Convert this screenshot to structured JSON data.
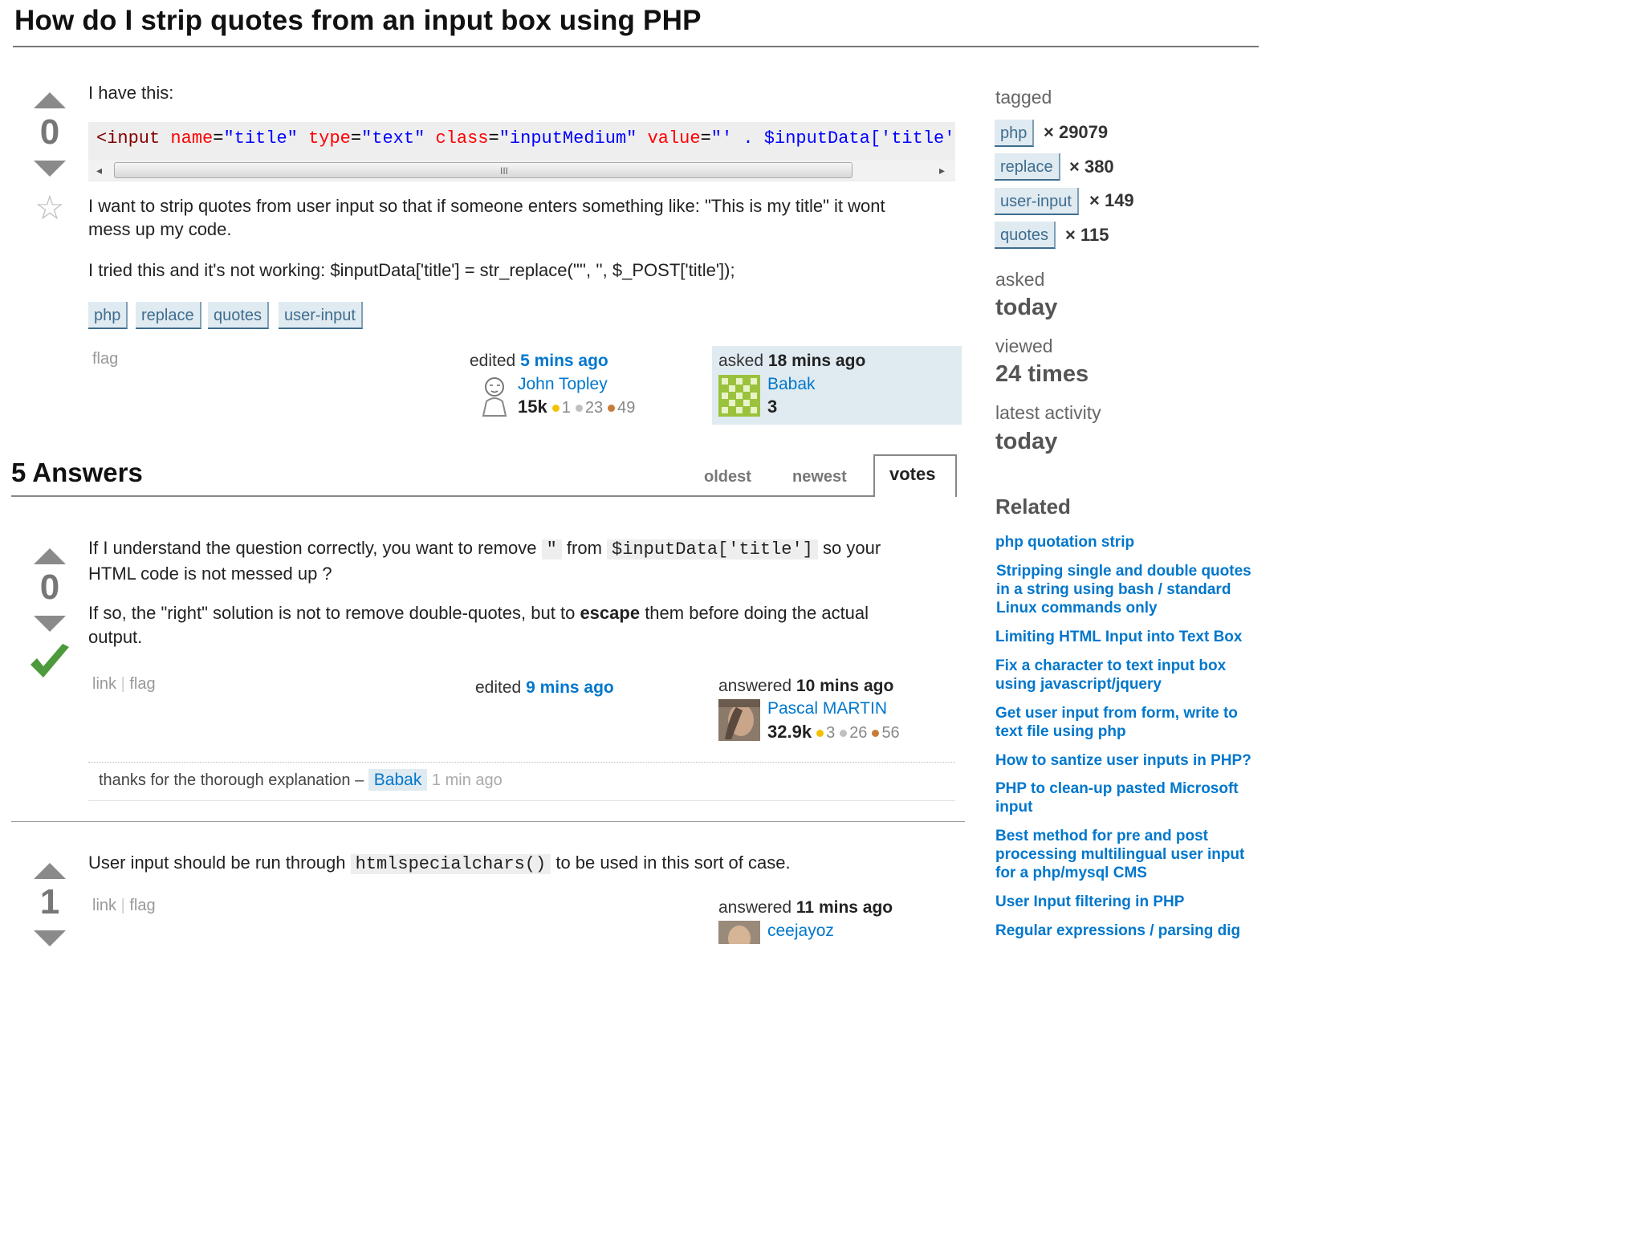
{
  "question": {
    "title": "How do I strip quotes from an input box using PHP",
    "votes": "0",
    "intro": "I have this:",
    "code": {
      "t1": "<input",
      "a1": "name",
      "v1": "\"title\"",
      "a2": "type",
      "v2": "\"text\"",
      "a3": "class",
      "v3": "\"inputMedium\"",
      "a4": "value",
      "v4": "\"'",
      "rest": " . $inputData['title']"
    },
    "para1_line1": "I want to strip quotes from user input so that if someone enters something like: \"This is my title\" it wont",
    "para1_line2": "mess up my code.",
    "para2": "I tried this and it's not working: $inputData['title'] = str_replace('\"', '', $_POST['title']);",
    "tags": [
      "php",
      "replace",
      "quotes",
      "user-input"
    ],
    "flag": "flag",
    "edited_label": "edited",
    "edited_time": "5 mins ago",
    "editor": {
      "name": "John Topley",
      "rep": "15k",
      "gold": "1",
      "silver": "23",
      "bronze": "49"
    },
    "asked_label": "asked",
    "asked_time": "18 mins ago",
    "owner": {
      "name": "Babak",
      "rep": "3"
    }
  },
  "answers_header": "5 Answers",
  "tabs": [
    "oldest",
    "newest",
    "votes"
  ],
  "answer1": {
    "votes": "0",
    "p1_a": "If I understand the question correctly, you want to remove",
    "p1_code1": "\"",
    "p1_b": "from",
    "p1_code2": "$inputData['title']",
    "p1_c": "so your",
    "p1_line2": "HTML code is not messed up ?",
    "p2_a": "If so, the \"right\" solution is not to remove double-quotes, but to",
    "p2_bold": "escape",
    "p2_b": "them before doing the actual",
    "p2_line2": "output.",
    "link": "link",
    "flag": "flag",
    "edited_label": "edited",
    "edited_time": "9 mins ago",
    "answered_label": "answered",
    "answered_time": "10 mins ago",
    "author": {
      "name": "Pascal MARTIN",
      "rep": "32.9k",
      "gold": "3",
      "silver": "26",
      "bronze": "56"
    },
    "comment": {
      "text": "thanks for the thorough explanation –",
      "user": "Babak",
      "time": "1 min ago"
    }
  },
  "answer2": {
    "votes": "1",
    "p1_a": "User input should be run through",
    "p1_code": "htmlspecialchars()",
    "p1_b": "to be used in this sort of case.",
    "link": "link",
    "flag": "flag",
    "answered_label": "answered",
    "answered_time": "11 mins ago",
    "author": {
      "name": "ceejayoz"
    }
  },
  "sidebar": {
    "tagged_label": "tagged",
    "tag_counts": [
      {
        "tag": "php",
        "count": "× 29079"
      },
      {
        "tag": "replace",
        "count": "× 380"
      },
      {
        "tag": "user-input",
        "count": "× 149"
      },
      {
        "tag": "quotes",
        "count": "× 115"
      }
    ],
    "asked_label": "asked",
    "asked_value": "today",
    "viewed_label": "viewed",
    "viewed_value": "24 times",
    "activity_label": "latest activity",
    "activity_value": "today",
    "related_title": "Related",
    "related": [
      "php quotation strip",
      "Stripping single and double quotes in a string using bash / standard Linux commands only",
      "Limiting HTML Input into Text Box",
      "Fix a character to text input box using javascript/jquery",
      "Get user input from form, write to text file using php",
      "How to santize user inputs in PHP?",
      "PHP to clean-up pasted Microsoft input",
      "Best method for pre and post processing multilingual user input for a php/mysql CMS",
      "User Input filtering in PHP",
      "Regular expressions / parsing dig"
    ]
  },
  "colors": {
    "link": "#0077cc",
    "tag_bg": "#e0eaf1",
    "accepted": "#4c9a3c"
  }
}
